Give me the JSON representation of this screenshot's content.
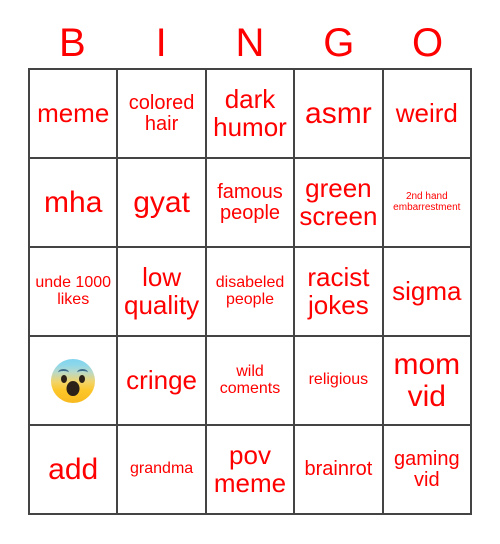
{
  "card": {
    "title_letters": [
      "B",
      "I",
      "N",
      "G",
      "O"
    ],
    "text_color": "#ff0000",
    "border_color": "#444444",
    "background_color": "#ffffff",
    "rows": [
      [
        {
          "text": "meme",
          "size": "sz-lg",
          "type": "text"
        },
        {
          "text": "colored hair",
          "size": "sz-md",
          "type": "text"
        },
        {
          "text": "dark humor",
          "size": "sz-lg",
          "type": "text"
        },
        {
          "text": "asmr",
          "size": "sz-xl",
          "type": "text"
        },
        {
          "text": "weird",
          "size": "sz-lg",
          "type": "text"
        }
      ],
      [
        {
          "text": "mha",
          "size": "sz-xl",
          "type": "text"
        },
        {
          "text": "gyat",
          "size": "sz-xl",
          "type": "text"
        },
        {
          "text": "famous people",
          "size": "sz-md",
          "type": "text"
        },
        {
          "text": "green screen",
          "size": "sz-lg",
          "type": "text"
        },
        {
          "text": "2nd hand embarrestment",
          "size": "sz-xs",
          "type": "text"
        }
      ],
      [
        {
          "text": "unde 1000 likes",
          "size": "sz-sm",
          "type": "text"
        },
        {
          "text": "low quality",
          "size": "sz-lg",
          "type": "text"
        },
        {
          "text": "disabeled people",
          "size": "sz-sm",
          "type": "text"
        },
        {
          "text": "racist jokes",
          "size": "sz-lg",
          "type": "text"
        },
        {
          "text": "sigma",
          "size": "sz-lg",
          "type": "text"
        }
      ],
      [
        {
          "text": "",
          "size": "sz-xl",
          "type": "emoji",
          "emoji_name": "fearful-face-emoji"
        },
        {
          "text": "cringe",
          "size": "sz-lg",
          "type": "text"
        },
        {
          "text": "wild coments",
          "size": "sz-sm",
          "type": "text"
        },
        {
          "text": "religious",
          "size": "sz-sm",
          "type": "text"
        },
        {
          "text": "mom vid",
          "size": "sz-xl",
          "type": "text"
        }
      ],
      [
        {
          "text": "add",
          "size": "sz-xl",
          "type": "text"
        },
        {
          "text": "grandma",
          "size": "sz-sm",
          "type": "text"
        },
        {
          "text": "pov meme",
          "size": "sz-lg",
          "type": "text"
        },
        {
          "text": "brainrot",
          "size": "sz-md",
          "type": "text"
        },
        {
          "text": "gaming vid",
          "size": "sz-md",
          "type": "text"
        }
      ]
    ]
  }
}
